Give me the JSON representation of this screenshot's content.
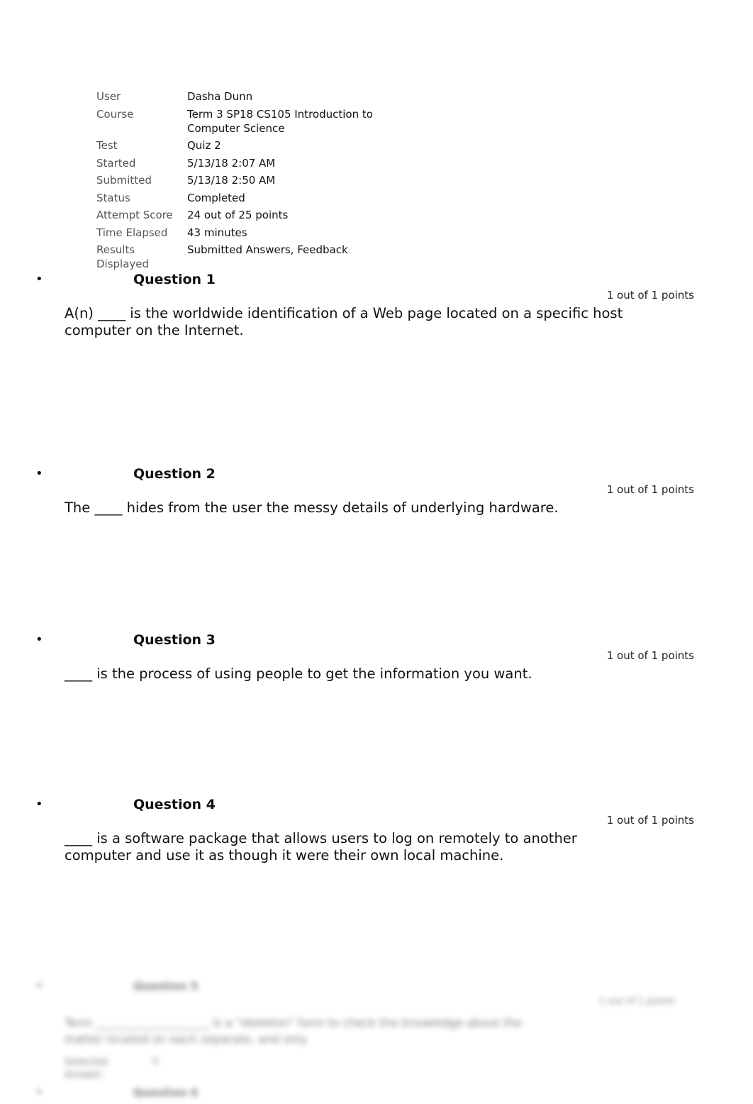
{
  "attempt_info": [
    {
      "label": "User",
      "value": "Dasha Dunn"
    },
    {
      "label": "Course",
      "value": "Term 3 SP18 CS105 Introduction to Computer Science"
    },
    {
      "label": "Test",
      "value": "Quiz 2"
    },
    {
      "label": "Started",
      "value": "5/13/18 2:07 AM"
    },
    {
      "label": "Submitted",
      "value": "5/13/18 2:50 AM"
    },
    {
      "label": "Status",
      "value": "Completed"
    },
    {
      "label": "Attempt Score",
      "value": "24 out of 25 points"
    },
    {
      "label": "Time Elapsed",
      "value": "43 minutes"
    },
    {
      "label": "Results Displayed",
      "value": "Submitted Answers, Feedback"
    }
  ],
  "bullet_glyph": "•",
  "questions": [
    {
      "title": "Question 1",
      "points": "1 out of 1 points",
      "text": "A(n) ____ is the worldwide identification of a Web page located on a specific host computer on the Internet."
    },
    {
      "title": "Question 2",
      "points": "1 out of 1 points",
      "text": "The ____ hides from the user the messy details of underlying hardware."
    },
    {
      "title": "Question 3",
      "points": "1 out of 1 points",
      "text": "____ is the process of using people to get the information you want."
    },
    {
      "title": "Question 4",
      "points": "1 out of 1 points",
      "text": "____ is a software package that allows users to log on remotely to another computer and use it as though it were their own local machine."
    }
  ],
  "blurred_section": {
    "q_title": "Question 5",
    "points": "1 out of 1 points",
    "text": "Term ____________________ is a \"skeleton\" form to check the knowledge about the matter located on each separate, and only",
    "answer_label_1": "Selected",
    "answer_label_2": "Answer:",
    "answer_value": "C",
    "next_title": "Question 6"
  }
}
